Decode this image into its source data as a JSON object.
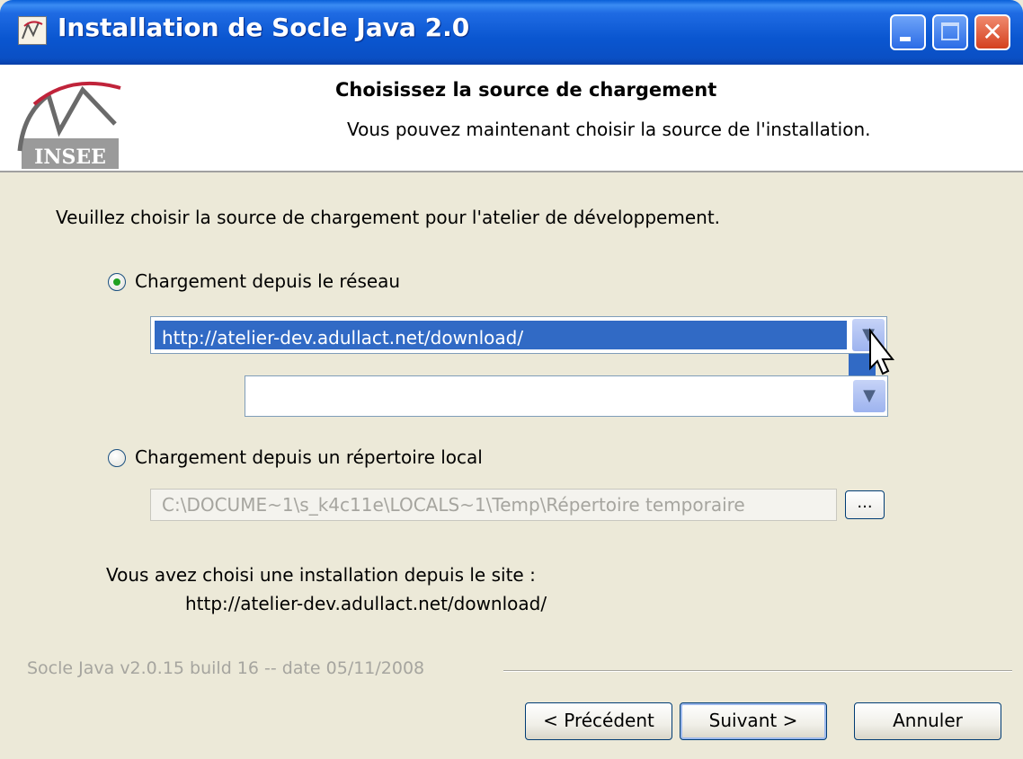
{
  "window": {
    "title": "Installation de Socle Java 2.0",
    "controls": {
      "minimize": "minimize-icon",
      "maximize": "maximize-icon",
      "close": "close-icon"
    }
  },
  "header": {
    "logo_text": "INSEE",
    "title": "Choisissez la source de chargement",
    "subtitle": "Vous pouvez maintenant choisir la source de l'installation."
  },
  "body": {
    "intro": "Veuillez choisir la source de chargement pour l'atelier de développement.",
    "options": [
      {
        "label": "Chargement depuis le réseau",
        "selected": true
      },
      {
        "label": "Chargement depuis un répertoire local",
        "selected": false
      }
    ],
    "network_url": "http://atelier-dev.adullact.net/download/",
    "local_path": "C:\\DOCUME~1\\s_k4c11e\\LOCALS~1\\Temp\\Répertoire temporaire",
    "browse_label": "...",
    "info_line1": "Vous avez choisi une installation depuis le site :",
    "info_line2": "http://atelier-dev.adullact.net/download/"
  },
  "footer": {
    "version": "Socle Java v2.0.15 build 16 -- date 05/11/2008",
    "buttons": {
      "previous": "< Précédent",
      "next": "Suivant >",
      "cancel": "Annuler"
    }
  },
  "colors": {
    "titlebar": "#0a56d0",
    "selection": "#316ac5",
    "dialog_bg": "#ece9d8",
    "logo_red": "#c0233a"
  }
}
